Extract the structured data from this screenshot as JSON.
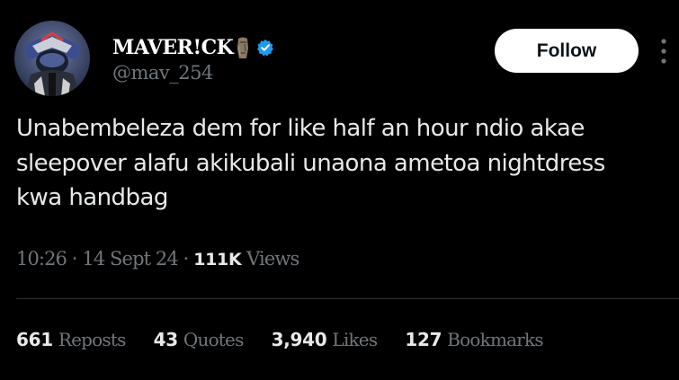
{
  "author": {
    "display_name": "MAVER!CK",
    "handle": "@mav_254",
    "avatar_icon": "avatar-image",
    "badge_icon": "moai-emoji",
    "verified_icon": "verified-badge",
    "verified_color": "#1d9bf0"
  },
  "follow_button": {
    "label": "Follow"
  },
  "more_icon": "vertical-ellipsis",
  "tweet": {
    "text": "Unabembeleza dem for like half an hour ndio akae\nsleepover alafu akikubali unaona ametoa nightdress\nkwa handbag"
  },
  "meta": {
    "time": "10:26",
    "date": "14 Sept 24",
    "separator": " · ",
    "views_count": "111K",
    "views_label": "Views"
  },
  "stats": [
    {
      "count": "661",
      "label": "Reposts"
    },
    {
      "count": "43",
      "label": "Quotes"
    },
    {
      "count": "3,940",
      "label": "Likes"
    },
    {
      "count": "127",
      "label": "Bookmarks"
    }
  ],
  "colors": {
    "background": "#000000",
    "primary_text": "#e7e9ea",
    "secondary_text": "#71767b",
    "divider": "#2f3336",
    "follow_bg": "#ffffff"
  }
}
